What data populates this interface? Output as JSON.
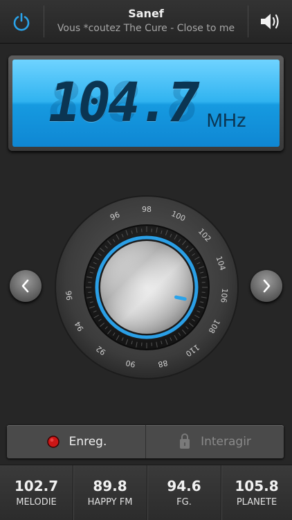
{
  "header": {
    "station_name": "Sanef",
    "rds_text": "Vous *coutez The Cure - Close to me",
    "power_icon": "power-icon",
    "volume_icon": "speaker-volume-icon"
  },
  "display": {
    "frequency": "104.7",
    "ghost_digits": "888.8",
    "unit": "MHz"
  },
  "dial": {
    "tick_labels": [
      "96",
      "98",
      "100",
      "102",
      "104",
      "106",
      "108",
      "110",
      "88",
      "90",
      "92",
      "94",
      "96"
    ],
    "prev_icon": "chevron-left-icon",
    "next_icon": "chevron-right-icon"
  },
  "actions": {
    "record_label": "Enreg.",
    "interact_label": "Interagir"
  },
  "presets": [
    {
      "freq": "102.7",
      "name": "MELODIE"
    },
    {
      "freq": "89.8",
      "name": "HAPPY FM"
    },
    {
      "freq": "94.6",
      "name": "FG."
    },
    {
      "freq": "105.8",
      "name": "PLANETE"
    }
  ],
  "colors": {
    "accent": "#29a0e6",
    "record": "#d01818",
    "lcd_text": "#0b3552"
  }
}
